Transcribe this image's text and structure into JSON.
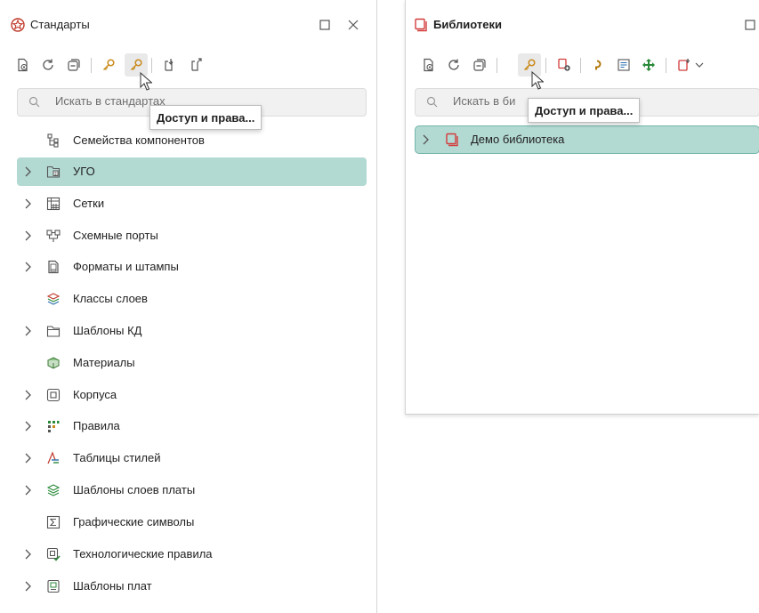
{
  "standards_panel": {
    "title": "Стандарты",
    "search_placeholder": "Искать в стандартах",
    "tooltip": "Доступ и права...",
    "items": [
      {
        "label": "Семейства компонентов",
        "expandable": false,
        "selected": false,
        "icon": "component-family-icon"
      },
      {
        "label": "УГО",
        "expandable": true,
        "selected": true,
        "icon": "ugo-icon"
      },
      {
        "label": "Сетки",
        "expandable": true,
        "selected": false,
        "icon": "grid-icon"
      },
      {
        "label": "Схемные порты",
        "expandable": true,
        "selected": false,
        "icon": "schematic-ports-icon"
      },
      {
        "label": "Форматы и штампы",
        "expandable": true,
        "selected": false,
        "icon": "format-stamp-icon"
      },
      {
        "label": "Классы слоев",
        "expandable": false,
        "selected": false,
        "icon": "layer-classes-icon"
      },
      {
        "label": "Шаблоны КД",
        "expandable": true,
        "selected": false,
        "icon": "folder-icon"
      },
      {
        "label": "Материалы",
        "expandable": false,
        "selected": false,
        "icon": "materials-icon"
      },
      {
        "label": "Корпуса",
        "expandable": true,
        "selected": false,
        "icon": "package-icon"
      },
      {
        "label": "Правила",
        "expandable": true,
        "selected": false,
        "icon": "rules-icon"
      },
      {
        "label": "Таблицы стилей",
        "expandable": true,
        "selected": false,
        "icon": "style-tables-icon"
      },
      {
        "label": "Шаблоны слоев платы",
        "expandable": true,
        "selected": false,
        "icon": "board-layer-templates-icon"
      },
      {
        "label": "Графические символы",
        "expandable": false,
        "selected": false,
        "icon": "sigma-icon"
      },
      {
        "label": "Технологические правила",
        "expandable": true,
        "selected": false,
        "icon": "tech-rules-icon"
      },
      {
        "label": "Шаблоны плат",
        "expandable": true,
        "selected": false,
        "icon": "board-templates-icon"
      }
    ]
  },
  "libraries_panel": {
    "title": "Библиотеки",
    "search_placeholder": "Искать в би",
    "tooltip": "Доступ и права...",
    "items": [
      {
        "label": "Демо библиотека",
        "expandable": true,
        "selected": true,
        "icon": "library-book-icon"
      }
    ]
  },
  "colors": {
    "selection": "#b3d9d3",
    "selection_border": "#72b5aa",
    "library_red": "#d23c3c",
    "accent_green": "#2a8a3a",
    "key_orange": "#c98a1a"
  }
}
